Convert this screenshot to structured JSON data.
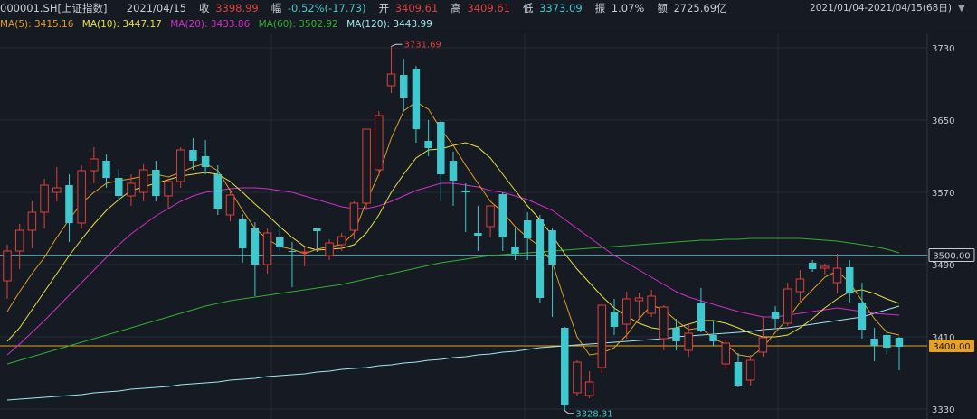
{
  "header": {
    "code": "000001.SH[上证指数]",
    "date": "2021/04/15",
    "close_label": "收",
    "close": "3398.99",
    "change_label": "幅",
    "change": "-0.52%(-17.73)",
    "open_label": "开",
    "open": "3409.61",
    "high_label": "高",
    "high": "3409.61",
    "low_label": "低",
    "low": "3373.09",
    "amp_label": "振",
    "amplitude": "1.07%",
    "amount_label": "额",
    "amount": "2725.69亿"
  },
  "ma_legend": {
    "ma5": "MA(5): 3415.16",
    "ma10": "MA(10): 3447.17",
    "ma20": "MA(20): 3433.86",
    "ma60": "MA(60): 3502.92",
    "ma120": "MA(120): 3443.99",
    "range": "2021/01/04-2021/04/15(68日)"
  },
  "colors": {
    "up": "#e0403a",
    "down": "#3fc9cf",
    "ma5": "#e0a020",
    "ma10": "#e8e040",
    "ma20": "#d030c8",
    "ma60": "#30b030",
    "ma120": "#a0e8f0",
    "hline_price": "#e8a020",
    "hline_ma": "#3aa8a8"
  },
  "price_tags": {
    "current": "3400.00",
    "ref": "3500.00"
  },
  "chart_data": {
    "type": "candlestick",
    "ylim": [
      3320,
      3750
    ],
    "y_ticks": [
      "3730",
      "3650",
      "3570",
      "3490",
      "3410",
      "3330"
    ],
    "annotations": {
      "high": "3731.69",
      "low": "3328.31"
    },
    "ohlc": [
      [
        3472,
        3512,
        3452,
        3505
      ],
      [
        3505,
        3535,
        3485,
        3528
      ],
      [
        3528,
        3560,
        3508,
        3548
      ],
      [
        3548,
        3585,
        3530,
        3578
      ],
      [
        3570,
        3598,
        3560,
        3575
      ],
      [
        3578,
        3590,
        3515,
        3536
      ],
      [
        3536,
        3600,
        3530,
        3594
      ],
      [
        3594,
        3620,
        3580,
        3607
      ],
      [
        3605,
        3612,
        3575,
        3586
      ],
      [
        3586,
        3596,
        3560,
        3566
      ],
      [
        3566,
        3590,
        3555,
        3580
      ],
      [
        3570,
        3601,
        3560,
        3595
      ],
      [
        3595,
        3605,
        3560,
        3566
      ],
      [
        3566,
        3585,
        3552,
        3582
      ],
      [
        3582,
        3620,
        3575,
        3617
      ],
      [
        3617,
        3630,
        3595,
        3605
      ],
      [
        3610,
        3628,
        3590,
        3598
      ],
      [
        3590,
        3600,
        3545,
        3552
      ],
      [
        3545,
        3572,
        3538,
        3567
      ],
      [
        3540,
        3546,
        3492,
        3508
      ],
      [
        3530,
        3537,
        3455,
        3490
      ],
      [
        3490,
        3530,
        3480,
        3525
      ],
      [
        3520,
        3533,
        3505,
        3509
      ],
      [
        3505,
        3515,
        3465,
        3504
      ],
      [
        3503,
        3509,
        3488,
        3504
      ],
      [
        3530,
        3530,
        3504,
        3527
      ],
      [
        3500,
        3518,
        3495,
        3514
      ],
      [
        3512,
        3525,
        3505,
        3521
      ],
      [
        3528,
        3560,
        3518,
        3558
      ],
      [
        3558,
        3640,
        3550,
        3640
      ],
      [
        3595,
        3660,
        3588,
        3655
      ],
      [
        3688,
        3732,
        3680,
        3701
      ],
      [
        3700,
        3718,
        3660,
        3675
      ],
      [
        3707,
        3710,
        3625,
        3640
      ],
      [
        3627,
        3650,
        3610,
        3619
      ],
      [
        3648,
        3650,
        3560,
        3590
      ],
      [
        3605,
        3615,
        3555,
        3583
      ],
      [
        3572,
        3580,
        3526,
        3570
      ],
      [
        3525,
        3555,
        3505,
        3522
      ],
      [
        3532,
        3555,
        3520,
        3555
      ],
      [
        3568,
        3570,
        3505,
        3520
      ],
      [
        3510,
        3530,
        3495,
        3502
      ],
      [
        3539,
        3548,
        3495,
        3519
      ],
      [
        3540,
        3545,
        3448,
        3453
      ],
      [
        3528,
        3530,
        3432,
        3490
      ],
      [
        3420,
        3421,
        3328,
        3334
      ],
      [
        3348,
        3384,
        3345,
        3382
      ],
      [
        3345,
        3372,
        3342,
        3360
      ],
      [
        3376,
        3448,
        3370,
        3445
      ],
      [
        3438,
        3452,
        3412,
        3421
      ],
      [
        3424,
        3460,
        3408,
        3452
      ],
      [
        3450,
        3459,
        3430,
        3453
      ],
      [
        3436,
        3462,
        3432,
        3455
      ],
      [
        3408,
        3445,
        3395,
        3443
      ],
      [
        3420,
        3430,
        3395,
        3405
      ],
      [
        3395,
        3425,
        3388,
        3414
      ],
      [
        3448,
        3464,
        3415,
        3417
      ],
      [
        3412,
        3428,
        3400,
        3405
      ],
      [
        3380,
        3407,
        3373,
        3403
      ],
      [
        3382,
        3392,
        3354,
        3356
      ],
      [
        3362,
        3390,
        3356,
        3384
      ],
      [
        3393,
        3432,
        3388,
        3409
      ],
      [
        3438,
        3444,
        3420,
        3430
      ],
      [
        3425,
        3470,
        3422,
        3463
      ],
      [
        3460,
        3484,
        3448,
        3474
      ],
      [
        3492,
        3495,
        3482,
        3485
      ],
      [
        3486,
        3491,
        3478,
        3488
      ],
      [
        3470,
        3502,
        3458,
        3486
      ],
      [
        3487,
        3495,
        3448,
        3458
      ],
      [
        3448,
        3470,
        3408,
        3418
      ],
      [
        3408,
        3420,
        3383,
        3400
      ],
      [
        3412,
        3418,
        3390,
        3398
      ],
      [
        3409,
        3410,
        3373,
        3399
      ]
    ],
    "ma5": [
      3438,
      3460,
      3480,
      3498,
      3520,
      3540,
      3558,
      3570,
      3580,
      3583,
      3585,
      3588,
      3590,
      3587,
      3592,
      3598,
      3602,
      3594,
      3572,
      3550,
      3530,
      3518,
      3510,
      3507,
      3502,
      3507,
      3510,
      3512,
      3525,
      3560,
      3590,
      3630,
      3660,
      3670,
      3662,
      3640,
      3622,
      3600,
      3580,
      3560,
      3548,
      3532,
      3520,
      3510,
      3492,
      3450,
      3410,
      3390,
      3392,
      3398,
      3412,
      3430,
      3445,
      3440,
      3428,
      3418,
      3420,
      3408,
      3402,
      3390,
      3388,
      3398,
      3415,
      3430,
      3448,
      3462,
      3476,
      3483,
      3470,
      3450,
      3430,
      3415,
      3412
    ],
    "ma10": [
      3405,
      3420,
      3440,
      3460,
      3480,
      3500,
      3518,
      3535,
      3550,
      3562,
      3572,
      3576,
      3580,
      3584,
      3588,
      3590,
      3592,
      3590,
      3582,
      3570,
      3557,
      3545,
      3532,
      3520,
      3510,
      3506,
      3507,
      3508,
      3512,
      3525,
      3545,
      3570,
      3590,
      3608,
      3617,
      3618,
      3622,
      3625,
      3620,
      3608,
      3590,
      3572,
      3555,
      3540,
      3522,
      3502,
      3485,
      3470,
      3455,
      3442,
      3433,
      3425,
      3420,
      3418,
      3420,
      3424,
      3428,
      3428,
      3425,
      3420,
      3414,
      3410,
      3410,
      3412,
      3420,
      3430,
      3442,
      3452,
      3460,
      3462,
      3458,
      3452,
      3447
    ],
    "ma20": [
      3390,
      3402,
      3415,
      3428,
      3442,
      3456,
      3470,
      3484,
      3498,
      3512,
      3524,
      3534,
      3544,
      3552,
      3560,
      3566,
      3570,
      3572,
      3574,
      3575,
      3575,
      3574,
      3572,
      3570,
      3566,
      3562,
      3558,
      3554,
      3552,
      3552,
      3555,
      3560,
      3566,
      3572,
      3576,
      3580,
      3580,
      3578,
      3576,
      3572,
      3570,
      3566,
      3562,
      3556,
      3550,
      3540,
      3530,
      3520,
      3510,
      3500,
      3492,
      3484,
      3476,
      3468,
      3460,
      3454,
      3450,
      3446,
      3442,
      3438,
      3435,
      3432,
      3432,
      3434,
      3436,
      3438,
      3440,
      3442,
      3440,
      3438,
      3436,
      3435,
      3434
    ],
    "ma60": [
      3380,
      3384,
      3388,
      3392,
      3396,
      3400,
      3404,
      3408,
      3412,
      3416,
      3420,
      3424,
      3428,
      3432,
      3436,
      3440,
      3444,
      3447,
      3450,
      3452,
      3454,
      3456,
      3458,
      3460,
      3462,
      3464,
      3466,
      3468,
      3471,
      3474,
      3477,
      3480,
      3483,
      3486,
      3489,
      3492,
      3494,
      3496,
      3498,
      3500,
      3501,
      3502,
      3503,
      3504,
      3505,
      3506,
      3507,
      3508,
      3509,
      3510,
      3511,
      3512,
      3513,
      3514,
      3515,
      3516,
      3517,
      3517,
      3518,
      3518,
      3519,
      3519,
      3519,
      3519,
      3519,
      3518,
      3517,
      3516,
      3514,
      3512,
      3510,
      3507,
      3503
    ],
    "ma120": [
      3340,
      3341,
      3342,
      3343,
      3344,
      3345,
      3346,
      3348,
      3349,
      3350,
      3352,
      3353,
      3354,
      3355,
      3357,
      3358,
      3359,
      3360,
      3362,
      3363,
      3364,
      3366,
      3367,
      3368,
      3369,
      3371,
      3372,
      3374,
      3375,
      3376,
      3378,
      3379,
      3381,
      3382,
      3384,
      3385,
      3387,
      3388,
      3390,
      3391,
      3393,
      3394,
      3396,
      3398,
      3399,
      3400,
      3401,
      3402,
      3403,
      3404,
      3405,
      3406,
      3407,
      3408,
      3410,
      3411,
      3412,
      3413,
      3414,
      3415,
      3416,
      3418,
      3419,
      3420,
      3422,
      3424,
      3426,
      3428,
      3430,
      3432,
      3436,
      3440,
      3444
    ]
  }
}
